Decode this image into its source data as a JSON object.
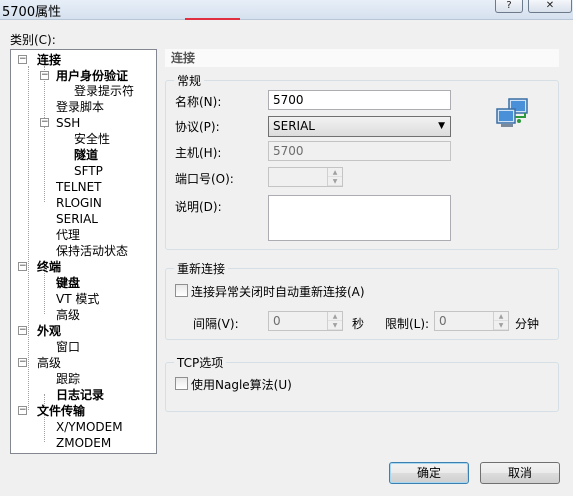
{
  "window": {
    "title": "5700属性",
    "help_button": "?",
    "close_button": "✕"
  },
  "category_label": "类别(C):",
  "tree": {
    "connection": "连接",
    "user_auth": "用户身份验证",
    "login_prompt": "登录提示符",
    "login_script": "登录脚本",
    "ssh": "SSH",
    "security": "安全性",
    "tunnel": "隧道",
    "sftp": "SFTP",
    "telnet": "TELNET",
    "rlogin": "RLOGIN",
    "serial": "SERIAL",
    "proxy": "代理",
    "keepalive": "保持活动状态",
    "terminal": "终端",
    "keyboard": "键盘",
    "vt_mode": "VT 模式",
    "terminal_advanced": "高级",
    "appearance": "外观",
    "window": "窗口",
    "advanced": "高级",
    "trace": "跟踪",
    "log": "日志记录",
    "file_transfer": "文件传输",
    "xymodem": "X/YMODEM",
    "zmodem": "ZMODEM"
  },
  "page_header": "连接",
  "general": {
    "title": "常规",
    "name_label": "名称(N):",
    "name_value": "5700",
    "protocol_label": "协议(P):",
    "protocol_value": "SERIAL",
    "host_label": "主机(H):",
    "host_value": "5700",
    "port_label": "端口号(O):",
    "port_value": "",
    "desc_label": "说明(D):",
    "desc_value": ""
  },
  "reconnect": {
    "title": "重新连接",
    "auto_label": "连接异常关闭时自动重新连接(A)",
    "interval_label": "间隔(V):",
    "interval_value": "0",
    "interval_unit": "秒",
    "limit_label": "限制(L):",
    "limit_value": "0",
    "limit_unit": "分钟"
  },
  "tcp": {
    "title": "TCP选项",
    "nagle_label": "使用Nagle算法(U)"
  },
  "buttons": {
    "ok": "确定",
    "cancel": "取消"
  },
  "icons": [
    "network-computers-icon",
    "dropdown-arrow-icon",
    "spin-up-icon",
    "spin-down-icon"
  ]
}
